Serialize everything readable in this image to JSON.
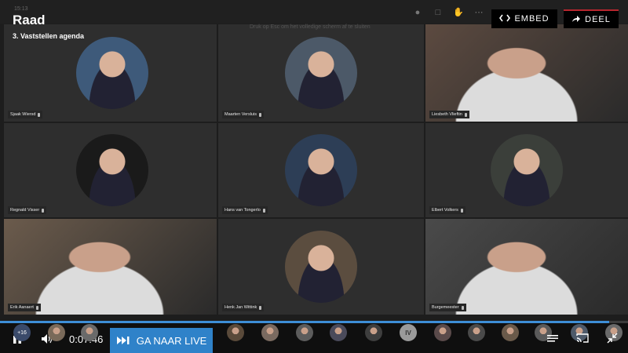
{
  "header": {
    "title": "Raad",
    "agenda_item": "3. Vaststellen agenda",
    "time_faint": "15:13",
    "banner_faint": "Druk op Esc om het volledige scherm af te sluiten",
    "embed_label": "EMBED",
    "share_label": "DEEL"
  },
  "participants": [
    {
      "name": "Sjaak Wiersd",
      "color": "#3e5a7a"
    },
    {
      "name": "Maarten Versluis",
      "color": "#4c5968"
    },
    {
      "name": "Liesbeth Vlieftin",
      "color": "#5c4a40"
    },
    {
      "name": "Regnald Visser",
      "color": "#1a1a1a"
    },
    {
      "name": "Hans van Tongerlo",
      "color": "#2d3e56"
    },
    {
      "name": "Elbert Volkers",
      "color": "#3b3f3a"
    },
    {
      "name": "Erik Aanaert",
      "color": "#6b5b4c"
    },
    {
      "name": "Henk Jan Wittink",
      "color": "#5b4d3f"
    },
    {
      "name": "Burgemeester",
      "color": "#4a4a4a"
    }
  ],
  "controls": {
    "timecode": "0:07:46",
    "live_label": "GA NAAR LIVE",
    "extra_count": "+16",
    "initials": "IV",
    "progress": 0.97
  },
  "colors": {
    "accent": "#2f82c9",
    "brand_red": "#b7262e"
  }
}
